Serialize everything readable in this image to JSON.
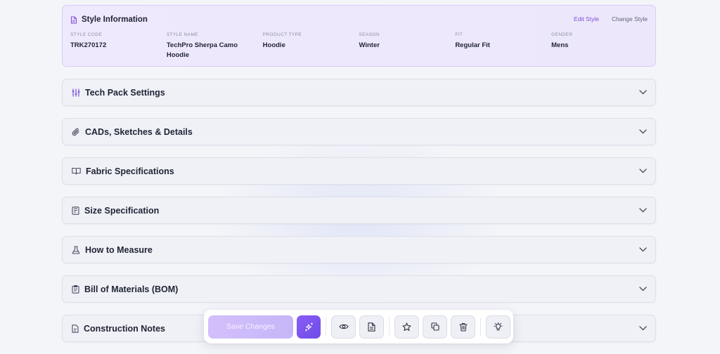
{
  "style_info": {
    "title": "Style Information",
    "edit_label": "Edit Style",
    "change_label": "Change Style",
    "fields": [
      {
        "label": "STYLE CODE",
        "value": "TRK270172"
      },
      {
        "label": "STYLE NAME",
        "value": "TechPro Sherpa Camo Hoodie"
      },
      {
        "label": "PRODUCT TYPE",
        "value": "Hoodie"
      },
      {
        "label": "SEASON",
        "value": "Winter"
      },
      {
        "label": "FIT",
        "value": "Regular Fit"
      },
      {
        "label": "GENDER",
        "value": "Mens"
      }
    ]
  },
  "sections": [
    {
      "title": "Tech Pack Settings",
      "icon": "sliders-icon"
    },
    {
      "title": "CADs, Sketches & Details",
      "icon": "paperclip-icon"
    },
    {
      "title": "Fabric Specifications",
      "icon": "book-open-icon"
    },
    {
      "title": "Size Specification",
      "icon": "ruler-sheet-icon"
    },
    {
      "title": "How to Measure",
      "icon": "flask-icon"
    },
    {
      "title": "Bill of Materials (BOM)",
      "icon": "clipboard-icon"
    },
    {
      "title": "Construction Notes",
      "icon": "document-icon"
    }
  ],
  "toolbar": {
    "save_label": "Save Changes",
    "buttons": [
      "sparkles-icon",
      "eye-icon",
      "file-text-icon",
      "star-icon",
      "copy-icon",
      "trash-icon",
      "lightbulb-icon"
    ]
  },
  "colors": {
    "accent": "#7c4fd8",
    "save_button": "#cdbaf9",
    "magic_button": "#7a54ef",
    "card_bg": "#eee8fc"
  }
}
